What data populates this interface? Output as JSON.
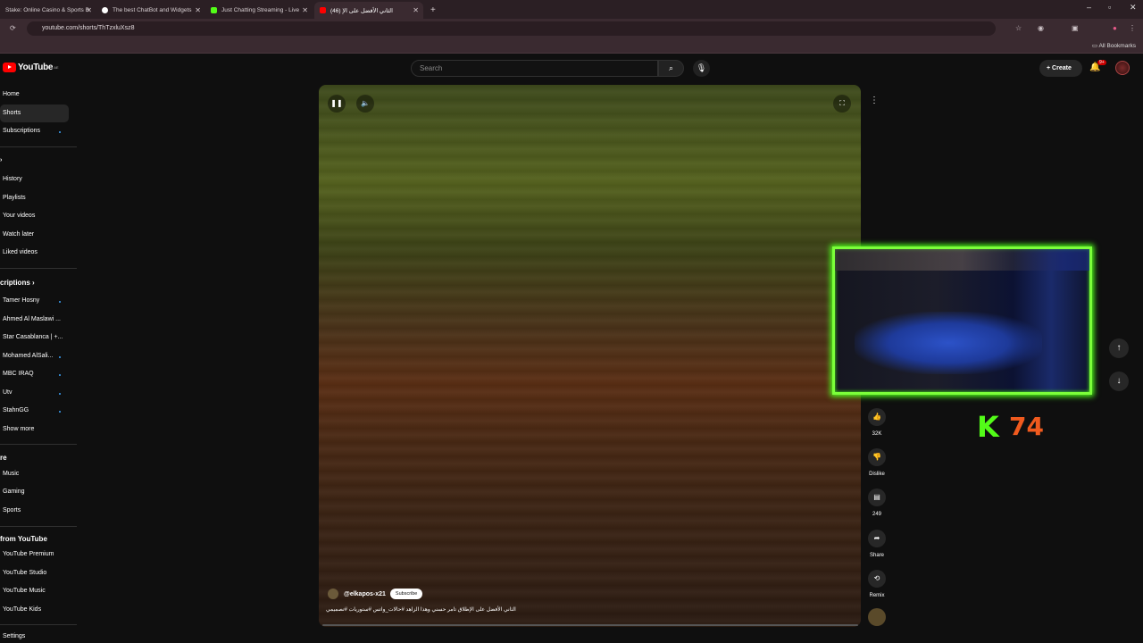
{
  "browser": {
    "tabs": [
      {
        "title": "Stake: Online Casino & Sports B",
        "color": "#1a2c38"
      },
      {
        "title": "The best ChatBot and Widgets",
        "color": "#ffffff"
      },
      {
        "title": "Just Chatting Streaming - Live",
        "color": "#53fc18"
      },
      {
        "title": "(46) الثاني الأفضل على الإ",
        "color": "#ff0000"
      }
    ],
    "new_tab": "+",
    "url": "youtube.com/shorts/ThTzxluXsz8",
    "bookmarks_label": "All Bookmarks",
    "window_controls": [
      "–",
      "▫",
      "✕"
    ]
  },
  "header": {
    "logo_text": "YouTube",
    "logo_sup": "AE",
    "search_placeholder": "Search",
    "create_label": "Create",
    "notif_badge": "9+"
  },
  "sidebar": {
    "main": [
      {
        "label": "Home",
        "active": false
      },
      {
        "label": "Shorts",
        "active": true
      },
      {
        "label": "Subscriptions",
        "active": false,
        "dot": true
      }
    ],
    "you": [
      {
        "label": "History"
      },
      {
        "label": "Playlists"
      },
      {
        "label": "Your videos"
      },
      {
        "label": "Watch later"
      },
      {
        "label": "Liked videos"
      }
    ],
    "subs_heading": "criptions",
    "subs": [
      {
        "label": "Tamer Hosny",
        "dot": true
      },
      {
        "label": "Ahmed Al Maslawi ...",
        "dot": false
      },
      {
        "label": "Star Casablanca | +...",
        "dot": false
      },
      {
        "label": "Mohamed AlSali...",
        "dot": true
      },
      {
        "label": "MBC IRAQ",
        "dot": true
      },
      {
        "label": "Utv",
        "dot": true
      },
      {
        "label": "StahnGG",
        "dot": true
      },
      {
        "label": "Show more",
        "dot": false
      }
    ],
    "explore_heading": "re",
    "explore": [
      {
        "label": "Music"
      },
      {
        "label": "Gaming"
      },
      {
        "label": "Sports"
      }
    ],
    "more_heading": "from YouTube",
    "more": [
      {
        "label": "YouTube Premium"
      },
      {
        "label": "YouTube Studio"
      },
      {
        "label": "YouTube Music"
      },
      {
        "label": "YouTube Kids"
      }
    ],
    "settings": "Settings"
  },
  "short": {
    "channel": "@elkapos-x21",
    "subscribe": "Subscribe",
    "title": "الثاني الأفضل على الإطلاق تامر حسني وهذا الزاهد #حالات_واتس #ستوريات #تصميمي"
  },
  "actions": {
    "likes": "32K",
    "dislike": "Dislike",
    "comments": "249",
    "share": "Share",
    "remix": "Remix"
  },
  "overlay": {
    "kick_logo": "K",
    "viewer_count": "74"
  }
}
